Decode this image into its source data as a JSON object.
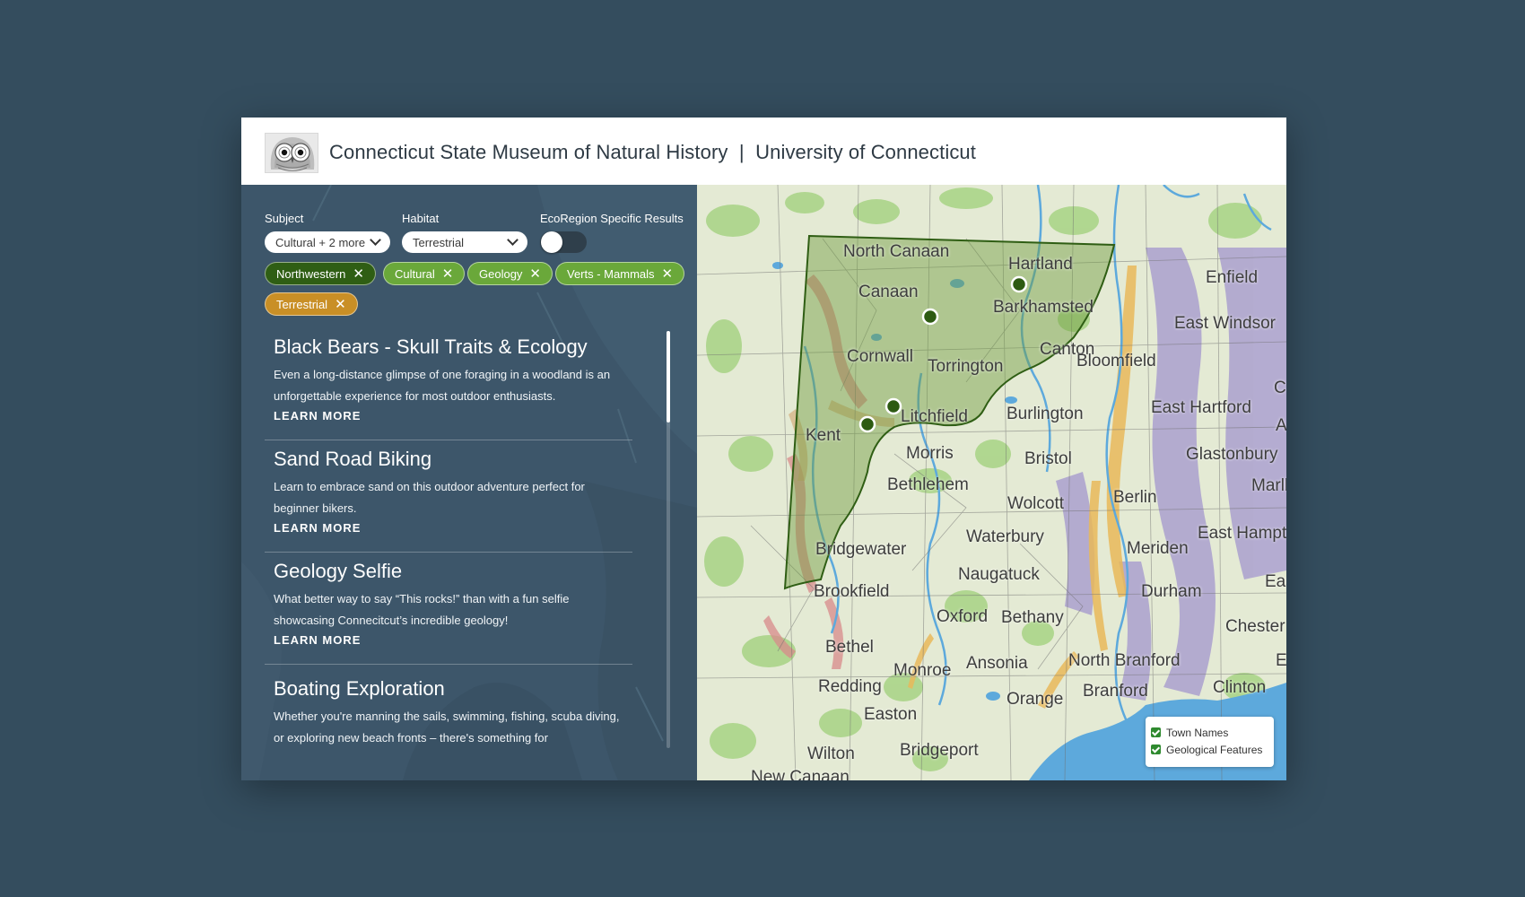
{
  "header": {
    "title": "Connecticut State Museum of Natural History  |  University of Connecticut"
  },
  "filters": {
    "subject": {
      "label": "Subject",
      "value": "Cultural + 2 more"
    },
    "habitat": {
      "label": "Habitat",
      "value": "Terrestrial"
    },
    "ecoregion": {
      "label": "EcoRegion Specific Results",
      "enabled": false
    }
  },
  "chips": [
    {
      "label": "Northwestern",
      "style": "dark"
    },
    {
      "label": "Cultural",
      "style": "light"
    },
    {
      "label": "Geology",
      "style": "light"
    },
    {
      "label": "Verts - Mammals",
      "style": "light"
    },
    {
      "label": "Terrestrial",
      "style": "gold"
    }
  ],
  "results": [
    {
      "title": "Black Bears - Skull Traits & Ecology",
      "description": "Even a long-distance glimpse of one foraging in a woodland is an unforgettable experience for most outdoor enthusiasts.",
      "link": "LEARN MORE"
    },
    {
      "title": "Sand Road Biking",
      "description": "Learn to embrace sand on this outdoor adventure perfect for beginner bikers.",
      "link": "LEARN MORE"
    },
    {
      "title": "Geology Selfie",
      "description": "What better way to say “This rocks!” than with a fun selfie showcasing Connecitcut’s incredible geology!",
      "link": "LEARN MORE"
    },
    {
      "title": "Boating Exploration",
      "description": " Whether you're manning the sails, swimming, fishing, scuba diving, or exploring new beach fronts – there's something for",
      "link": ""
    }
  ],
  "map": {
    "towns": [
      "North Canaan",
      "Hartland",
      "Enfield",
      "Canaan",
      "Barkhamsted",
      "East Windsor",
      "Cornwall",
      "Torrington",
      "Canton",
      "Bloomfield",
      "Litchfield",
      "Burlington",
      "East Hartford",
      "Kent",
      "Morris",
      "Bristol",
      "Glastonbury",
      "Bethlehem",
      "Wolcott",
      "Berlin",
      "Marlbor",
      "East Hampt",
      "Waterbury",
      "Meriden",
      "Bridgewater",
      "Naugatuck",
      "Brookfield",
      "Durham",
      "East",
      "Oxford",
      "Bethany",
      "Chester",
      "Bethel",
      "Ansonia",
      "North Branford",
      "E",
      "Monroe",
      "Branford",
      "Redding",
      "Orange",
      "Clinton",
      "Easton",
      "Wilton",
      "Bridgeport",
      "New Canaan",
      "C",
      "A"
    ],
    "legend": [
      "Town Names",
      "Geological Features"
    ],
    "colors": {
      "region": "#5e8f2f",
      "marker": "#2d5a12",
      "water": "#5da9dc"
    }
  }
}
